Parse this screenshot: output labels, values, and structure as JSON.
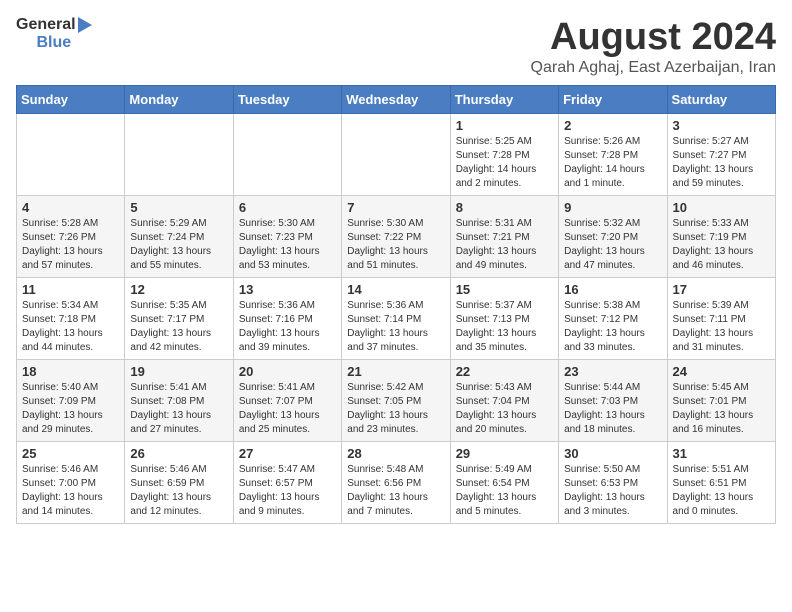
{
  "header": {
    "logo_general": "General",
    "logo_blue": "Blue",
    "month_title": "August 2024",
    "location": "Qarah Aghaj, East Azerbaijan, Iran"
  },
  "weekdays": [
    "Sunday",
    "Monday",
    "Tuesday",
    "Wednesday",
    "Thursday",
    "Friday",
    "Saturday"
  ],
  "weeks": [
    [
      {
        "day": "",
        "info": ""
      },
      {
        "day": "",
        "info": ""
      },
      {
        "day": "",
        "info": ""
      },
      {
        "day": "",
        "info": ""
      },
      {
        "day": "1",
        "info": "Sunrise: 5:25 AM\nSunset: 7:28 PM\nDaylight: 14 hours\nand 2 minutes."
      },
      {
        "day": "2",
        "info": "Sunrise: 5:26 AM\nSunset: 7:28 PM\nDaylight: 14 hours\nand 1 minute."
      },
      {
        "day": "3",
        "info": "Sunrise: 5:27 AM\nSunset: 7:27 PM\nDaylight: 13 hours\nand 59 minutes."
      }
    ],
    [
      {
        "day": "4",
        "info": "Sunrise: 5:28 AM\nSunset: 7:26 PM\nDaylight: 13 hours\nand 57 minutes."
      },
      {
        "day": "5",
        "info": "Sunrise: 5:29 AM\nSunset: 7:24 PM\nDaylight: 13 hours\nand 55 minutes."
      },
      {
        "day": "6",
        "info": "Sunrise: 5:30 AM\nSunset: 7:23 PM\nDaylight: 13 hours\nand 53 minutes."
      },
      {
        "day": "7",
        "info": "Sunrise: 5:30 AM\nSunset: 7:22 PM\nDaylight: 13 hours\nand 51 minutes."
      },
      {
        "day": "8",
        "info": "Sunrise: 5:31 AM\nSunset: 7:21 PM\nDaylight: 13 hours\nand 49 minutes."
      },
      {
        "day": "9",
        "info": "Sunrise: 5:32 AM\nSunset: 7:20 PM\nDaylight: 13 hours\nand 47 minutes."
      },
      {
        "day": "10",
        "info": "Sunrise: 5:33 AM\nSunset: 7:19 PM\nDaylight: 13 hours\nand 46 minutes."
      }
    ],
    [
      {
        "day": "11",
        "info": "Sunrise: 5:34 AM\nSunset: 7:18 PM\nDaylight: 13 hours\nand 44 minutes."
      },
      {
        "day": "12",
        "info": "Sunrise: 5:35 AM\nSunset: 7:17 PM\nDaylight: 13 hours\nand 42 minutes."
      },
      {
        "day": "13",
        "info": "Sunrise: 5:36 AM\nSunset: 7:16 PM\nDaylight: 13 hours\nand 39 minutes."
      },
      {
        "day": "14",
        "info": "Sunrise: 5:36 AM\nSunset: 7:14 PM\nDaylight: 13 hours\nand 37 minutes."
      },
      {
        "day": "15",
        "info": "Sunrise: 5:37 AM\nSunset: 7:13 PM\nDaylight: 13 hours\nand 35 minutes."
      },
      {
        "day": "16",
        "info": "Sunrise: 5:38 AM\nSunset: 7:12 PM\nDaylight: 13 hours\nand 33 minutes."
      },
      {
        "day": "17",
        "info": "Sunrise: 5:39 AM\nSunset: 7:11 PM\nDaylight: 13 hours\nand 31 minutes."
      }
    ],
    [
      {
        "day": "18",
        "info": "Sunrise: 5:40 AM\nSunset: 7:09 PM\nDaylight: 13 hours\nand 29 minutes."
      },
      {
        "day": "19",
        "info": "Sunrise: 5:41 AM\nSunset: 7:08 PM\nDaylight: 13 hours\nand 27 minutes."
      },
      {
        "day": "20",
        "info": "Sunrise: 5:41 AM\nSunset: 7:07 PM\nDaylight: 13 hours\nand 25 minutes."
      },
      {
        "day": "21",
        "info": "Sunrise: 5:42 AM\nSunset: 7:05 PM\nDaylight: 13 hours\nand 23 minutes."
      },
      {
        "day": "22",
        "info": "Sunrise: 5:43 AM\nSunset: 7:04 PM\nDaylight: 13 hours\nand 20 minutes."
      },
      {
        "day": "23",
        "info": "Sunrise: 5:44 AM\nSunset: 7:03 PM\nDaylight: 13 hours\nand 18 minutes."
      },
      {
        "day": "24",
        "info": "Sunrise: 5:45 AM\nSunset: 7:01 PM\nDaylight: 13 hours\nand 16 minutes."
      }
    ],
    [
      {
        "day": "25",
        "info": "Sunrise: 5:46 AM\nSunset: 7:00 PM\nDaylight: 13 hours\nand 14 minutes."
      },
      {
        "day": "26",
        "info": "Sunrise: 5:46 AM\nSunset: 6:59 PM\nDaylight: 13 hours\nand 12 minutes."
      },
      {
        "day": "27",
        "info": "Sunrise: 5:47 AM\nSunset: 6:57 PM\nDaylight: 13 hours\nand 9 minutes."
      },
      {
        "day": "28",
        "info": "Sunrise: 5:48 AM\nSunset: 6:56 PM\nDaylight: 13 hours\nand 7 minutes."
      },
      {
        "day": "29",
        "info": "Sunrise: 5:49 AM\nSunset: 6:54 PM\nDaylight: 13 hours\nand 5 minutes."
      },
      {
        "day": "30",
        "info": "Sunrise: 5:50 AM\nSunset: 6:53 PM\nDaylight: 13 hours\nand 3 minutes."
      },
      {
        "day": "31",
        "info": "Sunrise: 5:51 AM\nSunset: 6:51 PM\nDaylight: 13 hours\nand 0 minutes."
      }
    ]
  ]
}
